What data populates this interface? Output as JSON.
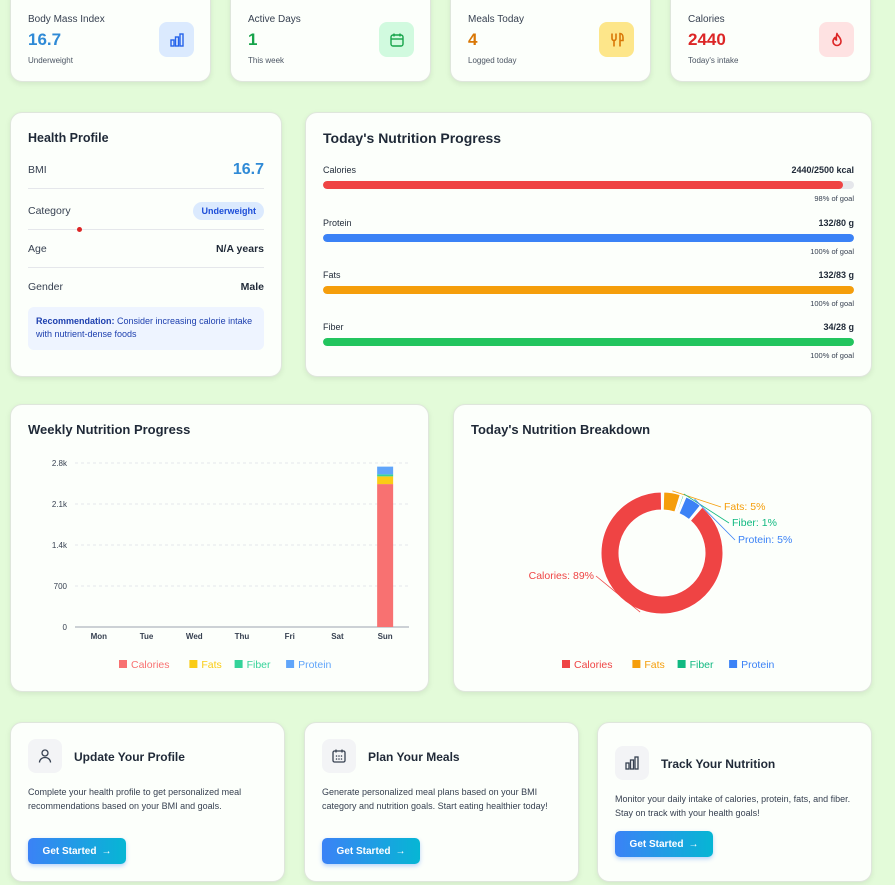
{
  "stats": [
    {
      "label": "Body Mass Index",
      "value": "16.7",
      "sub": "Underweight",
      "color": "#2f8ad6",
      "icon": "bar-chart-icon",
      "icon_bg": "#dbeafe"
    },
    {
      "label": "Active Days",
      "value": "1",
      "sub": "This week",
      "color": "#16a34a",
      "icon": "calendar-icon",
      "icon_bg": "#d1fadf"
    },
    {
      "label": "Meals Today",
      "value": "4",
      "sub": "Logged today",
      "color": "#d97706",
      "icon": "utensils-icon",
      "icon_bg": "#fde68a"
    },
    {
      "label": "Calories",
      "value": "2440",
      "sub": "Today's intake",
      "color": "#dc2626",
      "icon": "flame-icon",
      "icon_bg": "#fee2e2"
    }
  ],
  "health_profile": {
    "title": "Health Profile",
    "rows": [
      {
        "key": "BMI",
        "value": "16.7"
      },
      {
        "key": "Category",
        "value": "Underweight"
      },
      {
        "key": "Age",
        "value": "N/A years"
      },
      {
        "key": "Gender",
        "value": "Male"
      }
    ],
    "rec_label": "Recommendation:",
    "rec_text": "Consider increasing calorie intake with nutrient-dense foods"
  },
  "nutrition_progress": {
    "title": "Today's Nutrition Progress",
    "items": [
      {
        "name": "Calories",
        "amount": "2440/2500 kcal",
        "goal": "98% of goal",
        "progress": 0.98,
        "color": "#ef4444"
      },
      {
        "name": "Protein",
        "amount": "132/80 g",
        "goal": "100% of goal",
        "progress": 1.0,
        "color": "#3b82f6"
      },
      {
        "name": "Fats",
        "amount": "132/83 g",
        "goal": "100% of goal",
        "progress": 1.0,
        "color": "#f59e0b"
      },
      {
        "name": "Fiber",
        "amount": "34/28 g",
        "goal": "100% of goal",
        "progress": 1.0,
        "color": "#22c55e"
      }
    ]
  },
  "weekly": {
    "title": "Weekly Nutrition Progress"
  },
  "breakdown": {
    "title": "Today's Nutrition Breakdown"
  },
  "chart_data": [
    {
      "type": "bar",
      "title": "Weekly Nutrition Progress",
      "stacked": true,
      "categories": [
        "Mon",
        "Tue",
        "Wed",
        "Thu",
        "Fri",
        "Sat",
        "Sun"
      ],
      "yticks": [
        "0",
        "700",
        "1.4k",
        "2.1k",
        "2.8k"
      ],
      "ylim": [
        0,
        2800
      ],
      "grid": true,
      "legend": "bottom",
      "series": [
        {
          "name": "Calories",
          "color": "#f87171",
          "values": [
            0,
            0,
            0,
            0,
            0,
            0,
            2440
          ]
        },
        {
          "name": "Fats",
          "color": "#facc15",
          "values": [
            0,
            0,
            0,
            0,
            0,
            0,
            132
          ]
        },
        {
          "name": "Fiber",
          "color": "#34d399",
          "values": [
            0,
            0,
            0,
            0,
            0,
            0,
            34
          ]
        },
        {
          "name": "Protein",
          "color": "#60a5fa",
          "values": [
            0,
            0,
            0,
            0,
            0,
            0,
            132
          ]
        }
      ]
    },
    {
      "type": "pie",
      "title": "Today's Nutrition Breakdown",
      "donut": true,
      "legend": "bottom",
      "slices": [
        {
          "name": "Calories",
          "label": "Calories: 89%",
          "value": 89,
          "color": "#ef4444"
        },
        {
          "name": "Fats",
          "label": "Fats: 5%",
          "value": 5,
          "color": "#f59e0b"
        },
        {
          "name": "Fiber",
          "label": "Fiber: 1%",
          "value": 1,
          "color": "#10b981"
        },
        {
          "name": "Protein",
          "label": "Protein: 5%",
          "value": 5,
          "color": "#3b82f6"
        }
      ]
    }
  ],
  "actions": [
    {
      "title": "Update Your Profile",
      "desc": "Complete your health profile to get personalized meal recommendations based on your BMI and goals.",
      "button": "Get Started",
      "icon": "user-icon"
    },
    {
      "title": "Plan Your Meals",
      "desc": "Generate personalized meal plans based on your BMI category and nutrition goals. Start eating healthier today!",
      "button": "Get Started",
      "icon": "calendar-icon"
    },
    {
      "title": "Track Your Nutrition",
      "desc": "Monitor your daily intake of calories, protein, fats, and fiber. Stay on track with your health goals!",
      "button": "Get Started",
      "icon": "bar-chart-icon"
    }
  ]
}
